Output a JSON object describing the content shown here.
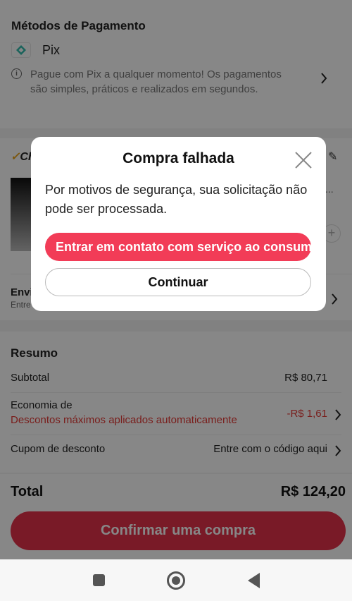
{
  "payment": {
    "title": "Métodos de Pagamento",
    "method_name": "Pix",
    "info_text": "Pague com Pix a qualquer momento! Os pagamentos são simples, práticos e realizados em segundos."
  },
  "product": {
    "choice_label": "Ch",
    "shipping_label": "Envi",
    "shipping_sub": "Entre",
    "dots": "..."
  },
  "summary": {
    "title": "Resumo",
    "subtotal_label": "Subtotal",
    "subtotal_value": "R$ 80,71",
    "economy_label": "Economia de",
    "economy_sub": "Descontos máximos aplicados automaticamente",
    "economy_value": "-R$ 1,61",
    "coupon_label": "Cupom de desconto",
    "coupon_value": "Entre com o código aqui"
  },
  "footer": {
    "total_label": "Total",
    "total_value": "R$ 124,20",
    "confirm_label": "Confirmar uma compra"
  },
  "modal": {
    "title": "Compra falhada",
    "message": "Por motivos de segurança, sua solicitação não pode ser processada.",
    "contact_button": "Entrar em contato com serviço ao consumidor",
    "continue_button": "Continuar"
  },
  "colors": {
    "accent_red": "#f23c57",
    "discount_red": "#e53935",
    "pix_teal": "#32bcad"
  }
}
